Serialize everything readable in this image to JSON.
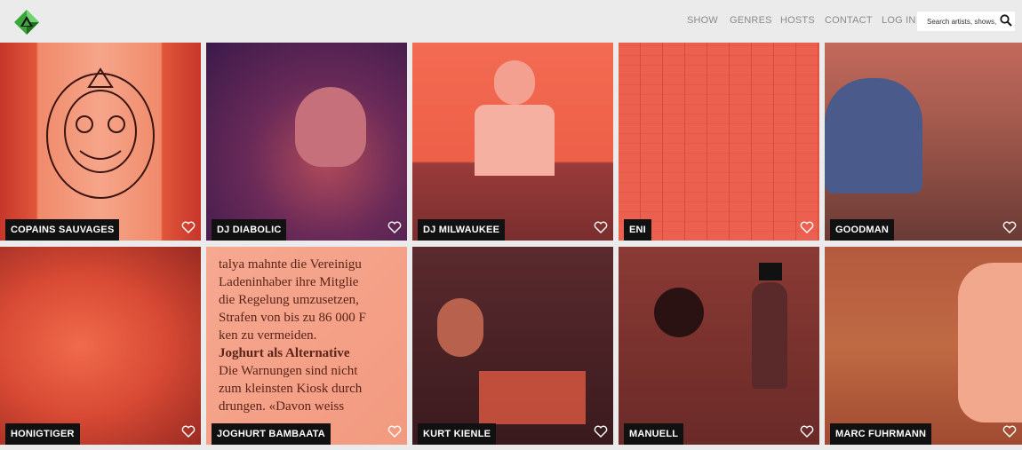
{
  "header": {
    "logo_icon": "diamond-cube-logo-icon",
    "nav": [
      "SHOW",
      "GENRES",
      "HOSTS",
      "CONTACT",
      "LOG IN"
    ],
    "search": {
      "placeholder": "Search artists, shows, ...",
      "icon": "search-icon"
    }
  },
  "tiles": [
    {
      "label": "COPAINS SAUVAGES",
      "favorite_icon": "heart-outline-icon"
    },
    {
      "label": "DJ DIABOLIC",
      "favorite_icon": "heart-outline-icon"
    },
    {
      "label": "DJ MILWAUKEE",
      "favorite_icon": "heart-outline-icon"
    },
    {
      "label": "ENI",
      "favorite_icon": "heart-outline-icon"
    },
    {
      "label": "GOODMAN",
      "favorite_icon": "heart-outline-icon"
    },
    {
      "label": "HONIGTIGER",
      "favorite_icon": "heart-outline-icon"
    },
    {
      "label": "JOGHURT BAMBAATA",
      "favorite_icon": "heart-outline-icon"
    },
    {
      "label": "KURT KIENLE",
      "favorite_icon": "heart-outline-icon"
    },
    {
      "label": "MANUELL",
      "favorite_icon": "heart-outline-icon"
    },
    {
      "label": "MARC FUHRMANN",
      "favorite_icon": "heart-outline-icon"
    }
  ],
  "colors": {
    "background": "#ebebeb",
    "label_bg": "#111111",
    "tint": "#e8543a"
  }
}
